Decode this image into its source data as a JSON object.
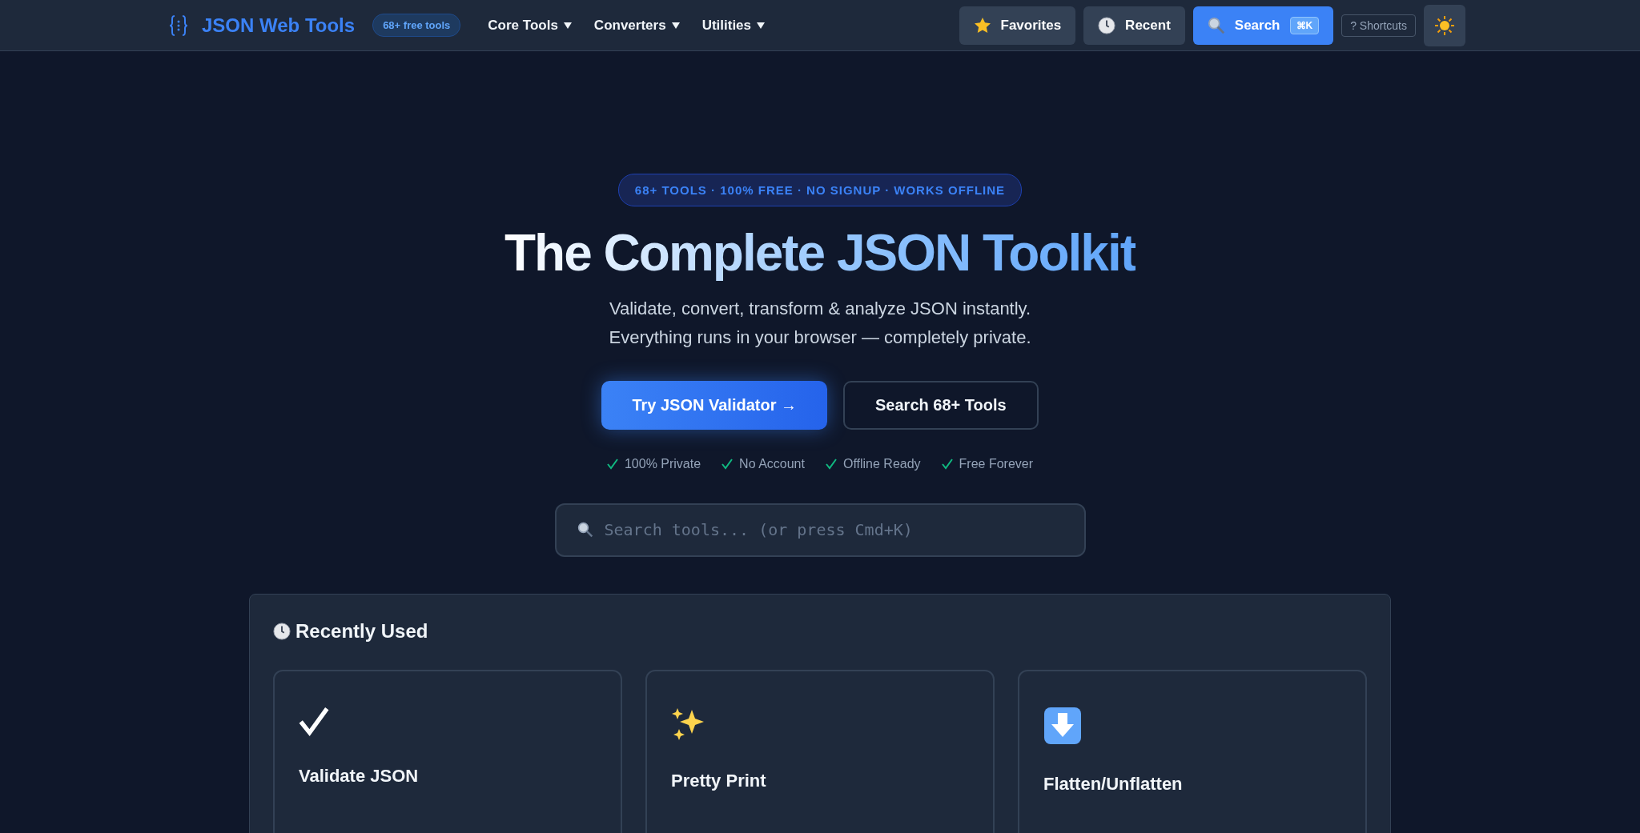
{
  "header": {
    "logo": "JSON Web Tools",
    "badge": "68+ free tools",
    "nav": [
      {
        "label": "Core Tools"
      },
      {
        "label": "Converters"
      },
      {
        "label": "Utilities"
      }
    ],
    "actions": [
      {
        "kind": "favorites",
        "label": "Favorites"
      },
      {
        "kind": "recent",
        "label": "Recent"
      },
      {
        "kind": "search",
        "label": "Search",
        "shortcut": "⌘K"
      }
    ],
    "shortcuts": "? Shortcuts"
  },
  "hero": {
    "pill": "68+ TOOLS · 100% FREE · NO SIGNUP · WORKS OFFLINE",
    "title": "The Complete JSON Toolkit",
    "lines": [
      "Validate, convert, transform & analyze JSON instantly.",
      "Everything runs in your browser — completely private."
    ],
    "primary": "Try JSON Validator →",
    "secondary": "Search 68+ Tools",
    "features": [
      "100% Private",
      "No Account",
      "Offline Ready",
      "Free Forever"
    ],
    "search": {
      "placeholder": "Search tools... (or press Cmd+K)"
    }
  },
  "recent": {
    "title": "Recently Used",
    "tools": [
      {
        "kind": "check",
        "name": "Validate JSON"
      },
      {
        "kind": "sparkles",
        "name": "Pretty Print"
      },
      {
        "kind": "down",
        "name": "Flatten/Unflatten"
      }
    ]
  }
}
